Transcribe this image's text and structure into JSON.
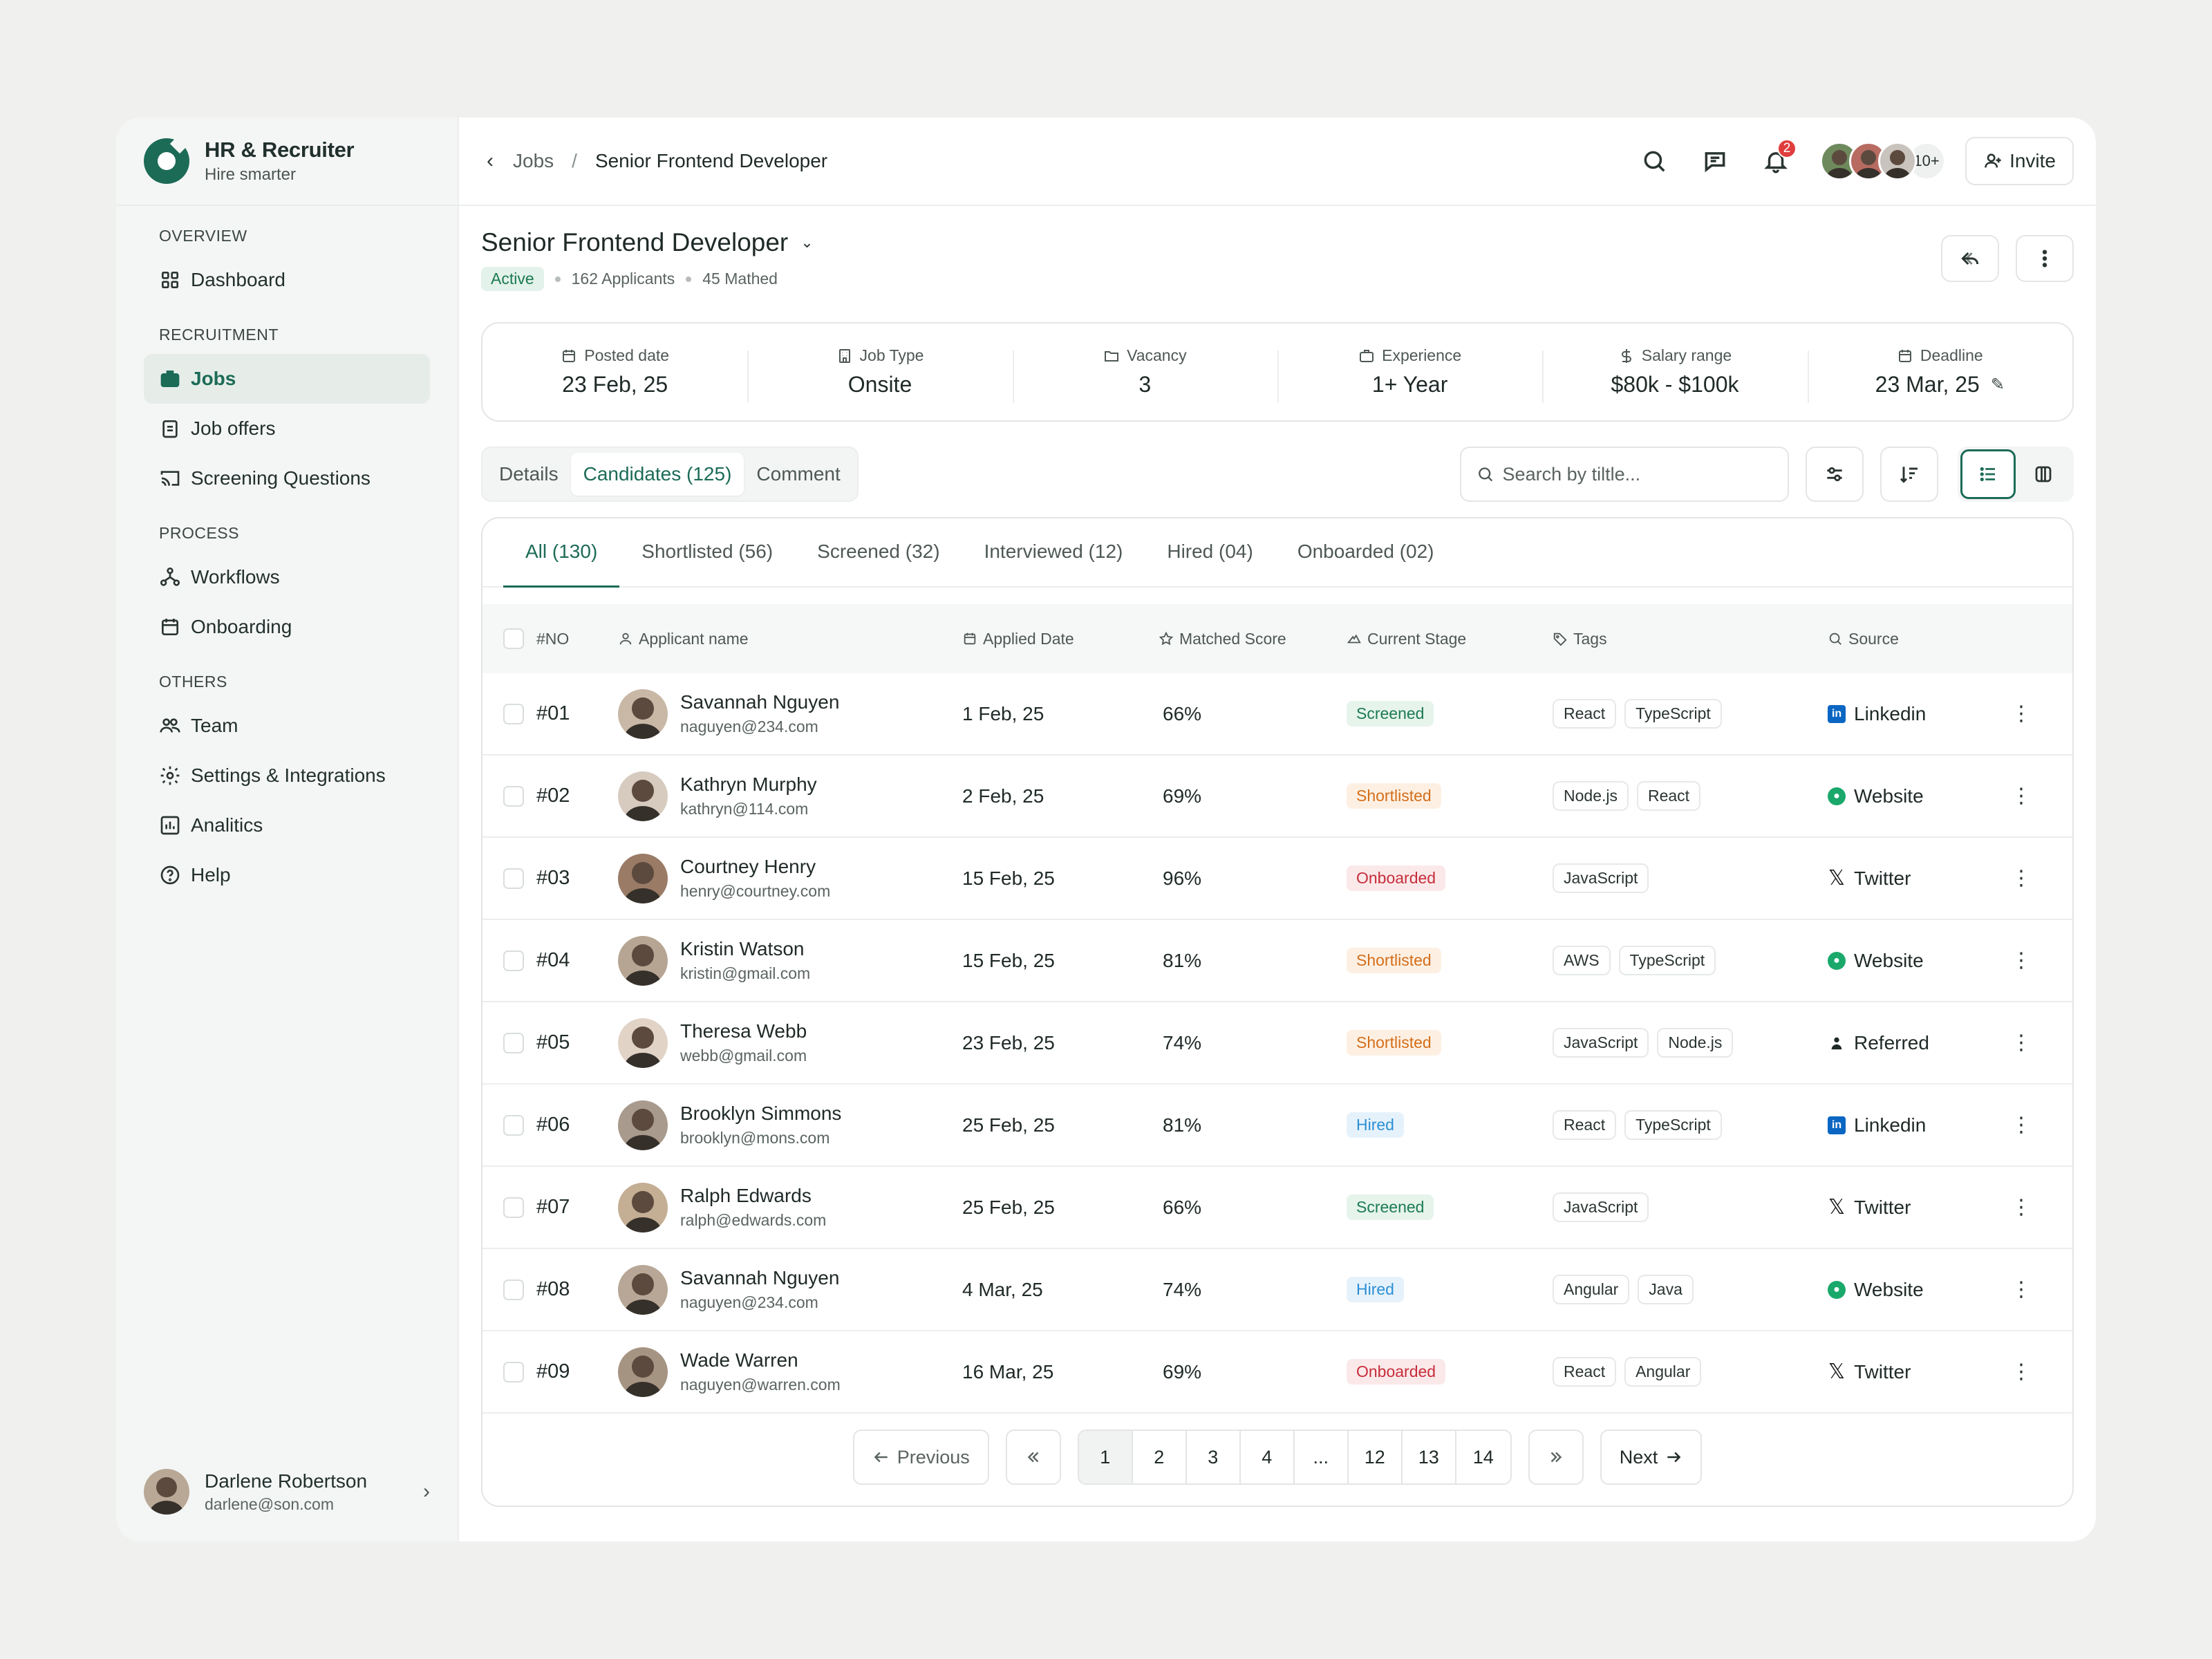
{
  "brand": {
    "title": "HR & Recruiter",
    "subtitle": "Hire smarter"
  },
  "sidebar": {
    "sections": [
      {
        "label": "OVERVIEW",
        "items": [
          {
            "label": "Dashboard",
            "icon": "grid-icon"
          }
        ]
      },
      {
        "label": "RECRUITMENT",
        "items": [
          {
            "label": "Jobs",
            "icon": "briefcase-icon",
            "active": true
          },
          {
            "label": "Job offers",
            "icon": "clipboard-icon"
          },
          {
            "label": "Screening Questions",
            "icon": "cast-icon"
          }
        ]
      },
      {
        "label": "PROCESS",
        "items": [
          {
            "label": "Workflows",
            "icon": "workflow-icon"
          },
          {
            "label": "Onboarding",
            "icon": "calendar-icon"
          }
        ]
      },
      {
        "label": "OTHERS",
        "items": [
          {
            "label": "Team",
            "icon": "team-icon"
          },
          {
            "label": "Settings & Integrations",
            "icon": "gear-icon"
          },
          {
            "label": "Analitics",
            "icon": "chart-icon"
          },
          {
            "label": "Help",
            "icon": "help-icon"
          }
        ]
      }
    ],
    "user": {
      "name": "Darlene Robertson",
      "email": "darlene@son.com"
    }
  },
  "topbar": {
    "crumb_parent": "Jobs",
    "crumb_sep": "/",
    "crumb_current": "Senior Frontend Developer",
    "notif_count": "2",
    "team_more": "10+",
    "invite_label": "Invite"
  },
  "job": {
    "title": "Senior Frontend Developer",
    "status": "Active",
    "applicants": "162 Applicants",
    "matched": "45 Mathed"
  },
  "stats": [
    {
      "label": "Posted date",
      "value": "23 Feb, 25",
      "icon": "calendar-icon"
    },
    {
      "label": "Job Type",
      "value": "Onsite",
      "icon": "building-icon"
    },
    {
      "label": "Vacancy",
      "value": "3",
      "icon": "folder-icon"
    },
    {
      "label": "Experience",
      "value": "1+ Year",
      "icon": "briefcase-icon"
    },
    {
      "label": "Salary range",
      "value": "$80k - $100k",
      "icon": "dollar-icon"
    },
    {
      "label": "Deadline",
      "value": "23 Mar, 25",
      "icon": "calendar-icon"
    }
  ],
  "tabs": [
    "Details",
    "Candidates (125)",
    "Comment"
  ],
  "search": {
    "placeholder": "Search by tiltle..."
  },
  "stage_tabs": [
    "All (130)",
    "Shortlisted (56)",
    "Screened (32)",
    "Interviewed (12)",
    "Hired (04)",
    "Onboarded (02)"
  ],
  "table": {
    "headers": {
      "no": "#NO",
      "name": "Applicant name",
      "date": "Applied Date",
      "score": "Matched Score",
      "stage": "Current Stage",
      "tags": "Tags",
      "source": "Source"
    },
    "rows": [
      {
        "no": "#01",
        "name": "Savannah Nguyen",
        "email": "naguyen@234.com",
        "date": "1 Feb, 25",
        "score": "66%",
        "stage": "Screened",
        "tags": [
          "React",
          "TypeScript"
        ],
        "source": "Linkedin"
      },
      {
        "no": "#02",
        "name": "Kathryn Murphy",
        "email": "kathryn@114.com",
        "date": "2 Feb, 25",
        "score": "69%",
        "stage": "Shortlisted",
        "tags": [
          "Node.js",
          "React"
        ],
        "source": "Website"
      },
      {
        "no": "#03",
        "name": "Courtney Henry",
        "email": "henry@courtney.com",
        "date": "15 Feb, 25",
        "score": "96%",
        "stage": "Onboarded",
        "tags": [
          "JavaScript"
        ],
        "source": "Twitter"
      },
      {
        "no": "#04",
        "name": "Kristin Watson",
        "email": "kristin@gmail.com",
        "date": "15 Feb, 25",
        "score": "81%",
        "stage": "Shortlisted",
        "tags": [
          "AWS",
          "TypeScript"
        ],
        "source": "Website"
      },
      {
        "no": "#05",
        "name": "Theresa Webb",
        "email": "webb@gmail.com",
        "date": "23 Feb, 25",
        "score": "74%",
        "stage": "Shortlisted",
        "tags": [
          "JavaScript",
          "Node.js"
        ],
        "source": "Referred"
      },
      {
        "no": "#06",
        "name": "Brooklyn Simmons",
        "email": "brooklyn@mons.com",
        "date": "25 Feb, 25",
        "score": "81%",
        "stage": "Hired",
        "tags": [
          "React",
          "TypeScript"
        ],
        "source": "Linkedin"
      },
      {
        "no": "#07",
        "name": "Ralph Edwards",
        "email": "ralph@edwards.com",
        "date": "25 Feb, 25",
        "score": "66%",
        "stage": "Screened",
        "tags": [
          "JavaScript"
        ],
        "source": "Twitter"
      },
      {
        "no": "#08",
        "name": "Savannah Nguyen",
        "email": "naguyen@234.com",
        "date": "4 Mar, 25",
        "score": "74%",
        "stage": "Hired",
        "tags": [
          "Angular",
          "Java"
        ],
        "source": "Website"
      },
      {
        "no": "#09",
        "name": "Wade Warren",
        "email": "naguyen@warren.com",
        "date": "16 Mar, 25",
        "score": "69%",
        "stage": "Onboarded",
        "tags": [
          "React",
          "Angular"
        ],
        "source": "Twitter"
      }
    ]
  },
  "pagination": {
    "previous": "Previous",
    "next": "Next",
    "pages": [
      "1",
      "2",
      "3",
      "4",
      "...",
      "12",
      "13",
      "14"
    ],
    "current": "1"
  },
  "colors": {
    "accent": "#1c6b57",
    "screened": "#1c7a53",
    "shortlisted": "#d46e1a",
    "onboarded": "#c62d3a",
    "hired": "#2c8fd5"
  }
}
